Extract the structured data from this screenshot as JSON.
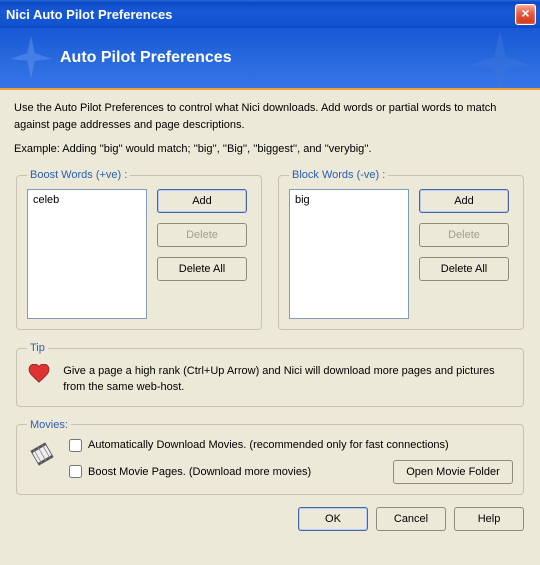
{
  "window": {
    "title": "Nici Auto Pilot Preferences"
  },
  "header": {
    "title": "Auto Pilot Preferences"
  },
  "intro": {
    "text": "Use the Auto Pilot Preferences to control what Nici downloads. Add words or partial words to match against page addresses and page descriptions.",
    "example": "Example: Adding ''big'' would match; ''big'', ''Big'', ''biggest'', and ''verybig''."
  },
  "boost": {
    "legend": "Boost Words (+ve) :",
    "items": [
      "celeb"
    ],
    "buttons": {
      "add": "Add",
      "delete": "Delete",
      "delete_all": "Delete All"
    }
  },
  "block": {
    "legend": "Block Words (-ve) :",
    "items": [
      "big"
    ],
    "buttons": {
      "add": "Add",
      "delete": "Delete",
      "delete_all": "Delete All"
    }
  },
  "tip": {
    "legend": "Tip",
    "text": "Give a page a high rank (Ctrl+Up Arrow) and Nici will download more pages and pictures from the same web-host."
  },
  "movies": {
    "legend": "Movies:",
    "auto_dl_label": "Automatically Download Movies. (recommended only for fast connections)",
    "auto_dl_checked": false,
    "boost_label": "Boost Movie Pages. (Download more movies)",
    "boost_checked": false,
    "open_folder": "Open Movie Folder"
  },
  "dialog": {
    "ok": "OK",
    "cancel": "Cancel",
    "help": "Help"
  }
}
